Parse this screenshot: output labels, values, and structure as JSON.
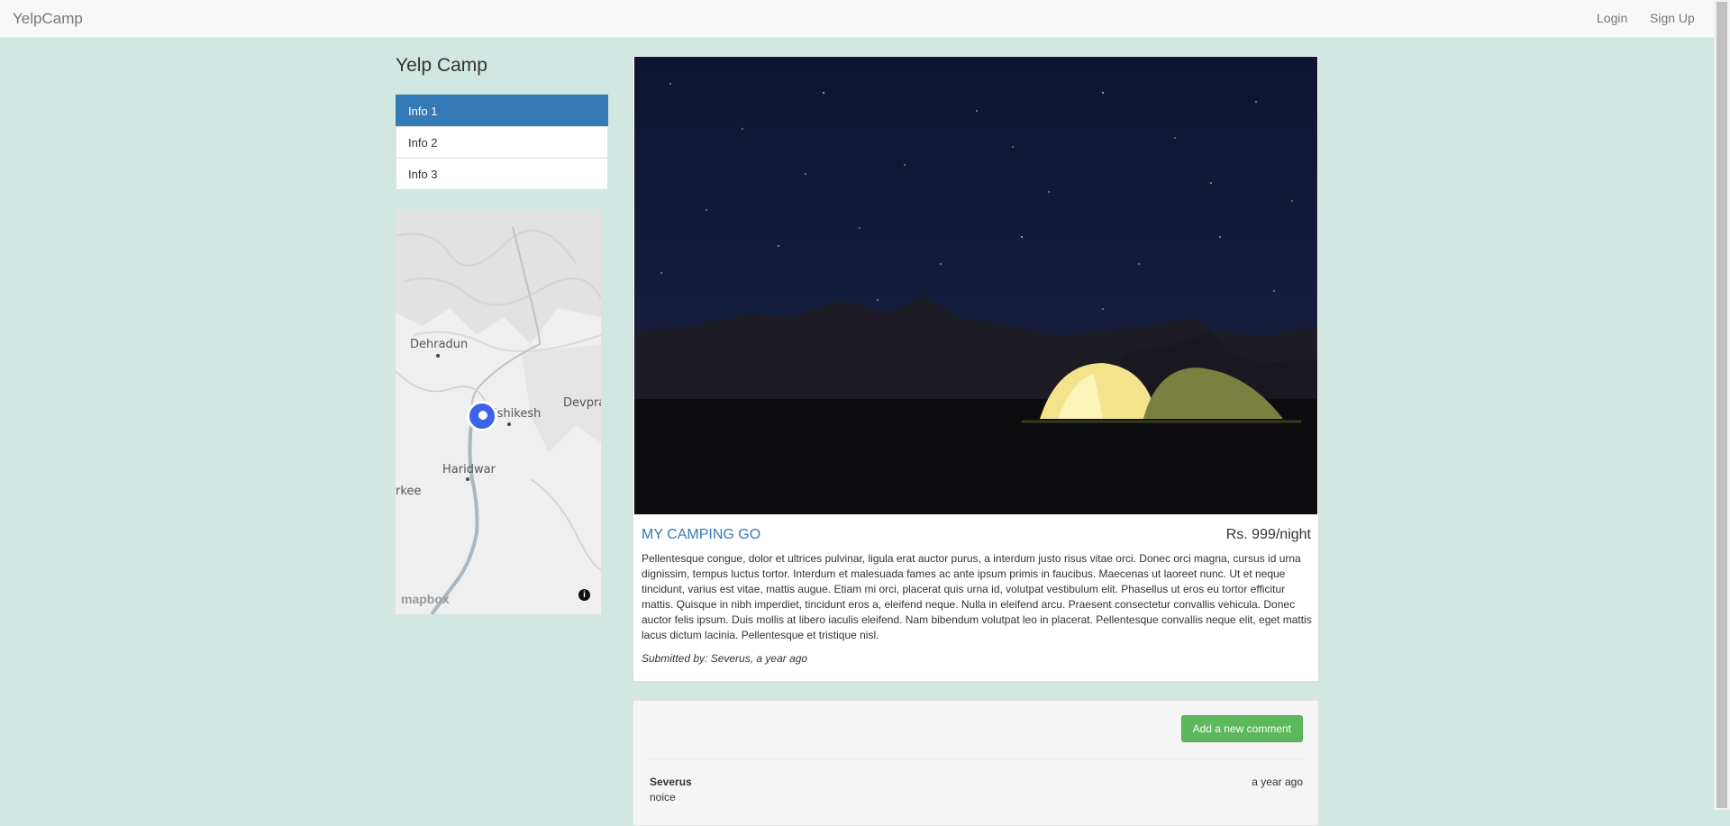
{
  "navbar": {
    "brand": "YelpCamp",
    "login": "Login",
    "signup": "Sign Up"
  },
  "sidebar": {
    "title": "Yelp Camp",
    "items": [
      {
        "label": "Info 1",
        "active": true
      },
      {
        "label": "Info 2",
        "active": false
      },
      {
        "label": "Info 3",
        "active": false
      }
    ]
  },
  "map": {
    "labels": [
      "Dehradun",
      "Rishikesh",
      "Devpray",
      "Haridwar",
      "rkee"
    ],
    "attribution": "mapbox",
    "info_icon": "i"
  },
  "campground": {
    "image_icon": "tent-night-photo",
    "name": "MY CAMPING GO",
    "price": "Rs. 999/night",
    "description": "Pellentesque congue, dolor et ultrices pulvinar, ligula erat auctor purus, a interdum justo risus vitae orci. Donec orci magna, cursus id urna dignissim, tempus luctus tortor. Interdum et malesuada fames ac ante ipsum primis in faucibus. Maecenas ut laoreet nunc. Ut et neque tincidunt, varius est vitae, mattis augue. Etiam mi orci, placerat quis urna id, volutpat vestibulum elit. Phasellus ut eros eu tortor efficitur mattis. Quisque in nibh imperdiet, tincidunt eros a, eleifend neque. Nulla in eleifend arcu. Praesent consectetur convallis vehicula. Donec auctor felis ipsum. Duis mollis at libero iaculis eleifend. Nam bibendum volutpat leo in placerat. Pellentesque convallis neque elit, eget mattis lacus dictum lacinia. Pellentesque et tristique nisl.",
    "submitted_by": "Submitted by: Severus, a year ago"
  },
  "comments": {
    "add_label": "Add a new comment",
    "items": [
      {
        "author": "Severus",
        "time": "a year ago",
        "text": "noice"
      }
    ]
  },
  "colors": {
    "background": "#d1e7e1",
    "primary": "#337ab7",
    "success": "#5cb85c"
  }
}
